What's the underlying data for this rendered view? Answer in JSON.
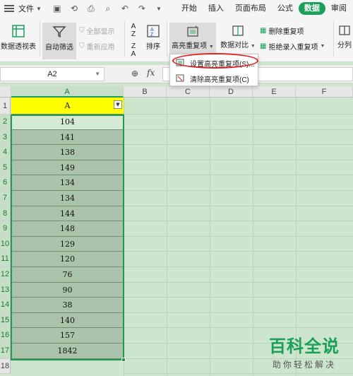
{
  "menubar": {
    "file_label": "文件",
    "tabs": [
      {
        "label": "开始",
        "active": false
      },
      {
        "label": "插入",
        "active": false
      },
      {
        "label": "页面布局",
        "active": false
      },
      {
        "label": "公式",
        "active": false
      },
      {
        "label": "数据",
        "active": true
      },
      {
        "label": "审阅",
        "active": false
      }
    ]
  },
  "ribbon": {
    "pivot": "数据透视表",
    "autofilter": "自动筛选",
    "show_all": "全部显示",
    "reapply": "重新应用",
    "sort": "排序",
    "highlight_dup": "高亮重复项",
    "compare": "数据对比",
    "remove_dup": "删除重复项",
    "reject_dup": "拒绝录入重复项",
    "split": "分列"
  },
  "dropdown": {
    "set_highlight": "设置高亮重复项(S)...",
    "clear_highlight": "清除高亮重复项(C)"
  },
  "formula_bar": {
    "name_box": "A2",
    "fx": "fx",
    "formula": ""
  },
  "grid": {
    "columns": [
      "A",
      "B",
      "C",
      "D",
      "E",
      "F"
    ],
    "header_cell": "A",
    "row_numbers": [
      "1",
      "2",
      "3",
      "4",
      "5",
      "6",
      "7",
      "8",
      "9",
      "10",
      "11",
      "12",
      "13",
      "14",
      "15",
      "16",
      "17",
      "18"
    ],
    "values": [
      "104",
      "141",
      "138",
      "149",
      "134",
      "134",
      "144",
      "148",
      "129",
      "120",
      "76",
      "90",
      "38",
      "140",
      "157",
      "1842"
    ]
  },
  "watermark": {
    "title": "百科全说",
    "subtitle": "助你轻松解决"
  },
  "colors": {
    "accent": "#1aa05a",
    "sheet_bg": "#cde5cd",
    "header_fill": "#ffff00",
    "highlight_ring": "#e02020"
  }
}
